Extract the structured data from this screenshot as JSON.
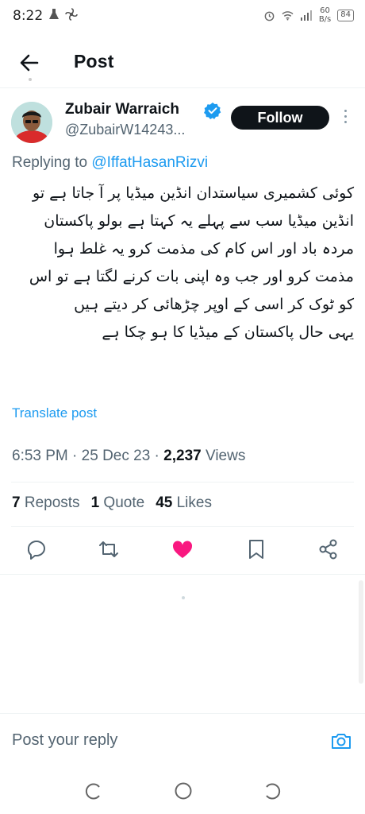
{
  "status_bar": {
    "time": "8:22",
    "net_speed_value": "60",
    "net_speed_unit": "B/s",
    "battery": "84"
  },
  "header": {
    "title": "Post",
    "back_icon": "arrow-left-icon"
  },
  "author": {
    "name": "Zubair Warraich",
    "handle": "@ZubairW14243...",
    "verified_icon": "verified-badge-icon",
    "follow_label": "Follow"
  },
  "reply": {
    "prefix": "Replying to ",
    "to": "@IffatHasanRizvi"
  },
  "post": {
    "text": "کوئی کشمیری سیاستدان انڈین میڈیا پر آ جاتا ہے تو انڈین میڈیا سب سے پہلے یہ کہتا ہے بولو پاکستان مردہ باد اور اس کام کی مذمت کرو یہ غلط ہوا مذمت کرو اور جب وہ اپنی بات کرنے لگتا ہے تو اس کو ٹوک کر اسی کے اوپر چڑھائی کر دیتے ہیں\nیہی حال پاکستان کے میڈیا کا ہو چکا ہے",
    "translate_label": "Translate post",
    "time": "6:53 PM",
    "date": "25 Dec 23",
    "views_count": "2,237",
    "views_label": "Views"
  },
  "stats": {
    "reposts_count": "7",
    "reposts_label": "Reposts",
    "quotes_count": "1",
    "quotes_label": "Quote",
    "likes_count": "45",
    "likes_label": "Likes"
  },
  "actions": {
    "reply_icon": "reply-bubble-icon",
    "repost_icon": "repost-icon",
    "like_icon": "heart-icon",
    "bookmark_icon": "bookmark-icon",
    "share_icon": "share-icon"
  },
  "composer": {
    "placeholder": "Post your reply",
    "camera_icon": "camera-icon"
  },
  "colors": {
    "accent": "#1d9bf0",
    "like": "#f91880",
    "text": "#0f1419",
    "secondary": "#536471"
  }
}
